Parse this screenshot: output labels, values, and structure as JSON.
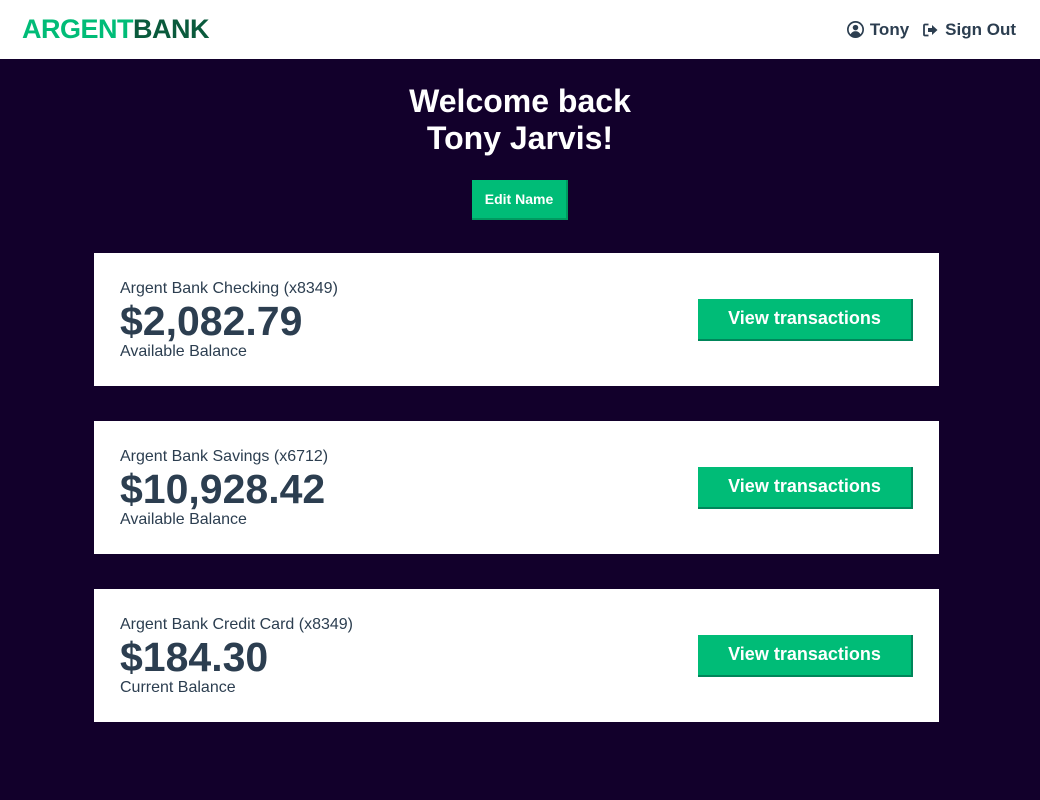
{
  "brand": {
    "part1": "ARGENT",
    "part2": "BANK",
    "color_primary": "#00bc77",
    "color_dark": "#0a5a3c"
  },
  "nav": {
    "user_label": "Tony",
    "user_icon": "user-circle-icon",
    "signout_label": "Sign Out",
    "signout_icon": "sign-out-icon"
  },
  "header": {
    "line1": "Welcome back",
    "line2": "Tony Jarvis!",
    "edit_label": "Edit Name"
  },
  "accounts": [
    {
      "title": "Argent Bank Checking (x8349)",
      "amount": "$2,082.79",
      "description": "Available Balance",
      "button_label": "View transactions"
    },
    {
      "title": "Argent Bank Savings (x6712)",
      "amount": "$10,928.42",
      "description": "Available Balance",
      "button_label": "View transactions"
    },
    {
      "title": "Argent Bank Credit Card (x8349)",
      "amount": "$184.30",
      "description": "Current Balance",
      "button_label": "View transactions"
    }
  ],
  "colors": {
    "background": "#12002b",
    "accent": "#00bc77",
    "text": "#2c3e50"
  }
}
